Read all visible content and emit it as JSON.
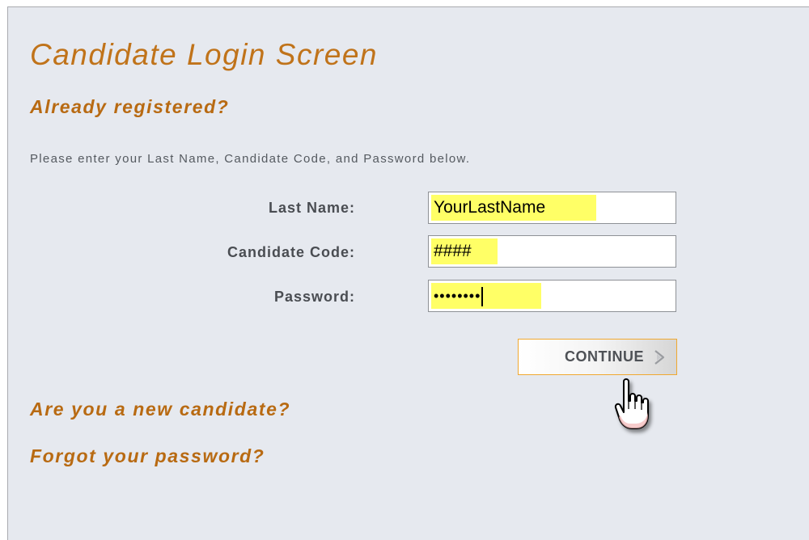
{
  "page": {
    "title": "Candidate Login Screen",
    "registered_heading": "Already registered?",
    "instruction": "Please enter your Last Name, Candidate Code, and Password below."
  },
  "form": {
    "last_name": {
      "label": "Last Name:",
      "value": "YourLastName"
    },
    "candidate_code": {
      "label": "Candidate Code:",
      "value": "####"
    },
    "password": {
      "label": "Password:",
      "value": "••••••••"
    }
  },
  "actions": {
    "continue_label": "CONTINUE",
    "new_candidate_link": "Are you a new candidate?",
    "forgot_password_link": "Forgot your password?"
  },
  "icons": {
    "continue_arrow": "chevron-right-icon",
    "cursor": "hand-pointer-icon"
  },
  "colors": {
    "heading": "#b86a12",
    "highlight": "#ffff66",
    "button_border": "#f0a830",
    "panel_background": "#e6e9ef"
  }
}
